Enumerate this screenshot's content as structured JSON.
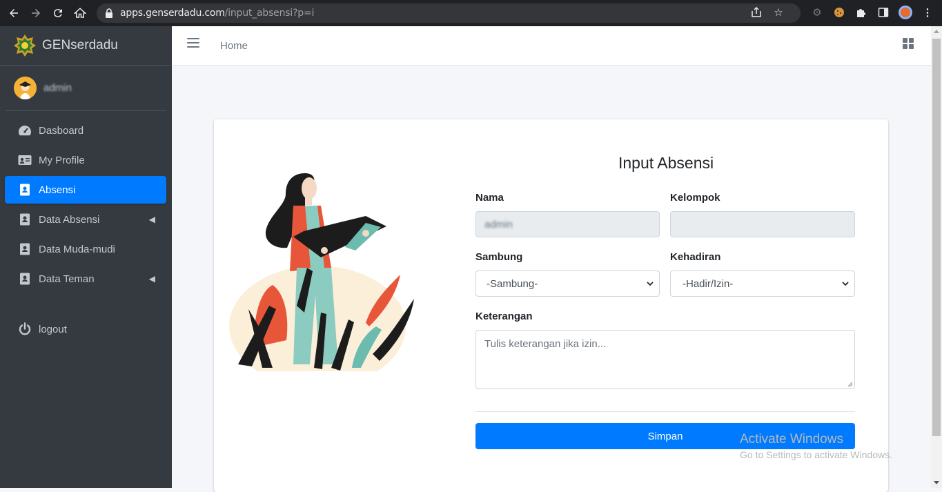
{
  "browser": {
    "url_host": "apps.genserdadu.com",
    "url_path": "/input_absensi?p=i"
  },
  "sidebar": {
    "brand": "GENserdadu",
    "user_name": "admin",
    "items": [
      {
        "label": "Dasboard",
        "icon": "dashboard-icon"
      },
      {
        "label": "My Profile",
        "icon": "id-card-icon"
      },
      {
        "label": "Absensi",
        "icon": "contact-book-icon",
        "active": true
      },
      {
        "label": "Data Absensi",
        "icon": "contact-book-icon",
        "has_submenu": true
      },
      {
        "label": "Data Muda-mudi",
        "icon": "contact-book-icon"
      },
      {
        "label": "Data Teman",
        "icon": "contact-book-icon",
        "has_submenu": true
      },
      {
        "label": "logout",
        "icon": "power-icon"
      }
    ]
  },
  "topbar": {
    "home_label": "Home"
  },
  "form": {
    "title": "Input Absensi",
    "nama_label": "Nama",
    "nama_value": "admin",
    "kelompok_label": "Kelompok",
    "kelompok_value": "",
    "sambung_label": "Sambung",
    "sambung_selected": "-Sambung-",
    "kehadiran_label": "Kehadiran",
    "kehadiran_selected": "-Hadir/Izin-",
    "keterangan_label": "Keterangan",
    "keterangan_placeholder": "Tulis keterangan jika izin...",
    "submit_label": "Simpan"
  },
  "watermark": {
    "line1": "Activate Windows",
    "line2": "Go to Settings to activate Windows."
  },
  "colors": {
    "accent": "#007bff",
    "sidebar_bg": "#343a40"
  }
}
